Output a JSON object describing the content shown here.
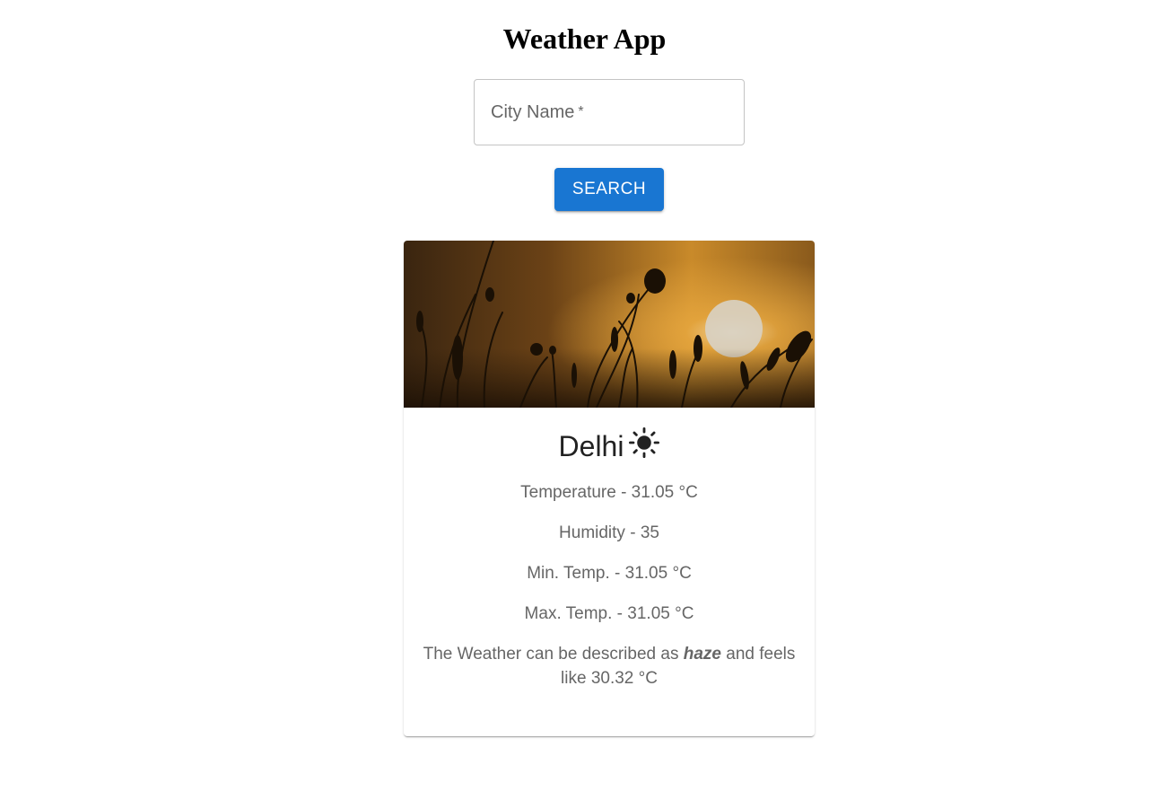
{
  "app": {
    "title": "Weather App"
  },
  "search": {
    "label": "City Name",
    "required_mark": "*",
    "value": "",
    "button_label": "SEARCH"
  },
  "weather": {
    "city": "Delhi",
    "condition_icon": "sun-icon",
    "temperature": "Temperature - 31.05 °C",
    "humidity": "Humidity - 35",
    "min_temp": "Min. Temp. - 31.05 °C",
    "max_temp": "Max. Temp. - 31.05 °C",
    "description_prefix": "The Weather can be described as ",
    "description_condition": "haze",
    "description_suffix": " and feels like 30.32 °C"
  },
  "colors": {
    "primary": "#1976d2"
  }
}
